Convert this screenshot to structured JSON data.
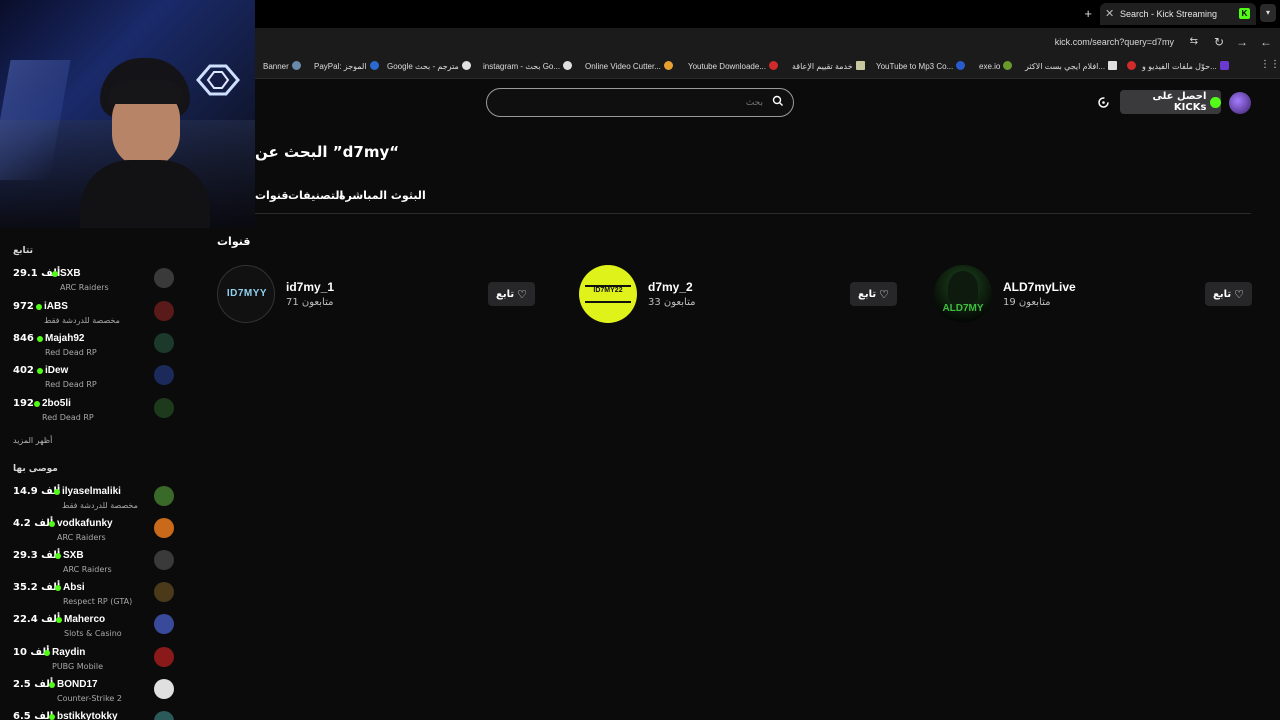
{
  "browser": {
    "tab_title": "Search - Kick Streaming",
    "new_tab": "+",
    "tab_close": "✕",
    "url": "kick.com/search?query=d7my",
    "bookmarks": [
      "Banner",
      "PayPal: الموجز",
      "Google مترجم - بحث",
      "instagram - بحث Go...",
      "Online Video Cutter...",
      "Youtube Downloade...",
      "خدمة تقييم الإعاقة",
      "YouTube to Mp3 Co...",
      "exe.io",
      "افلام ايجي بست الاكثر...",
      "حوّل ملفات الفيديو و..."
    ]
  },
  "header": {
    "search_placeholder": "بحث",
    "kicks_label": "احصل على KICKs"
  },
  "page": {
    "title": "البحث عن ”d7my“",
    "tabs": [
      "البثوث المباشرة",
      "التصنيفات",
      "قنوات"
    ],
    "channels_heading": "قنوات",
    "follow_label": "تابع",
    "channels": [
      {
        "name": "id7my_1",
        "followers": "71 متابعون",
        "avatar_text": "ID7MYY"
      },
      {
        "name": "d7my_2",
        "followers": "33 متابعون",
        "avatar_text": "ID7MY22"
      },
      {
        "name": "ALD7myLive",
        "followers": "19 متابعون",
        "avatar_text": "ALD7MY"
      }
    ]
  },
  "sidebar": {
    "following_heading": "تتابع",
    "show_more": "أظهر المزيد",
    "recommended_heading": "موصى بها",
    "following": [
      {
        "count": "29.1 ألف",
        "name": "SXB",
        "category": "ARC Raiders",
        "color": "#3a3a3a"
      },
      {
        "count": "972",
        "name": "iABS",
        "category": "مخصصة للدردشة فقط",
        "color": "#5a1a1a"
      },
      {
        "count": "846",
        "name": "Majah92",
        "category": "Red Dead RP",
        "color": "#1c3a2c"
      },
      {
        "count": "402",
        "name": "iDew",
        "category": "Red Dead RP",
        "color": "#1b2a5a"
      },
      {
        "count": "192",
        "name": "2bo5li",
        "category": "Red Dead RP",
        "color": "#1d3a1d"
      }
    ],
    "recommended": [
      {
        "count": "14.9 ألف",
        "name": "ilyaselmaliki",
        "category": "مخصصة للدردشة فقط",
        "color": "#3a6a2a"
      },
      {
        "count": "4.2 ألف",
        "name": "vodkafunky",
        "category": "ARC Raiders",
        "color": "#c86a1a"
      },
      {
        "count": "29.3 ألف",
        "name": "SXB",
        "category": "ARC Raiders",
        "color": "#3a3a3a"
      },
      {
        "count": "35.2 ألف",
        "name": "Absi",
        "category": "Respect RP (GTA)",
        "color": "#4a3a1a"
      },
      {
        "count": "22.4 ألف",
        "name": "Maherco",
        "category": "Slots & Casino",
        "color": "#3a4a9a"
      },
      {
        "count": "10 ألف",
        "name": "Raydin",
        "category": "PUBG Mobile",
        "color": "#8a1a1a"
      },
      {
        "count": "2.5 ألف",
        "name": "BOND17",
        "category": "Counter-Strike 2",
        "color": "#e0e0e0"
      },
      {
        "count": "6.5 ألف",
        "name": "bstikkytokky",
        "category": "",
        "color": "#2a5a5a"
      }
    ]
  }
}
